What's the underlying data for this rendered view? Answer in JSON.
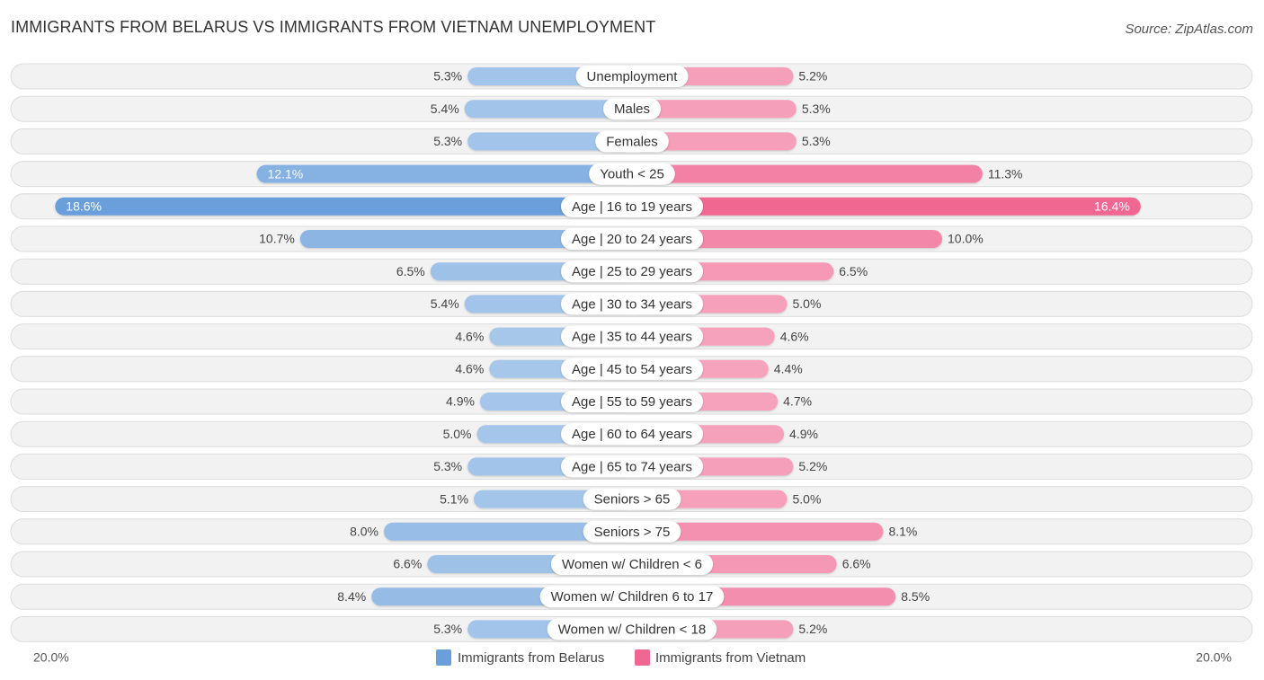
{
  "header": {
    "title": "IMMIGRANTS FROM BELARUS VS IMMIGRANTS FROM VIETNAM UNEMPLOYMENT",
    "source": "Source: ZipAtlas.com"
  },
  "colors": {
    "belarus": "#6a9fdc",
    "belarus_light": "#a9c8eb",
    "vietnam": "#f06792",
    "vietnam_light": "#f6a5bf"
  },
  "chart_data": {
    "type": "bar",
    "orientation": "diverging-horizontal",
    "title": "IMMIGRANTS FROM BELARUS VS IMMIGRANTS FROM VIETNAM UNEMPLOYMENT",
    "categories": [
      "Unemployment",
      "Males",
      "Females",
      "Youth < 25",
      "Age | 16 to 19 years",
      "Age | 20 to 24 years",
      "Age | 25 to 29 years",
      "Age | 30 to 34 years",
      "Age | 35 to 44 years",
      "Age | 45 to 54 years",
      "Age | 55 to 59 years",
      "Age | 60 to 64 years",
      "Age | 65 to 74 years",
      "Seniors > 65",
      "Seniors > 75",
      "Women w/ Children < 6",
      "Women w/ Children 6 to 17",
      "Women w/ Children < 18"
    ],
    "series": [
      {
        "name": "Immigrants from Belarus",
        "side": "left",
        "values": [
          5.3,
          5.4,
          5.3,
          12.1,
          18.6,
          10.7,
          6.5,
          5.4,
          4.6,
          4.6,
          4.9,
          5.0,
          5.3,
          5.1,
          8.0,
          6.6,
          8.4,
          5.3
        ],
        "labels": [
          "5.3%",
          "5.4%",
          "5.3%",
          "12.1%",
          "18.6%",
          "10.7%",
          "6.5%",
          "5.4%",
          "4.6%",
          "4.6%",
          "4.9%",
          "5.0%",
          "5.3%",
          "5.1%",
          "8.0%",
          "6.6%",
          "8.4%",
          "5.3%"
        ]
      },
      {
        "name": "Immigrants from Vietnam",
        "side": "right",
        "values": [
          5.2,
          5.3,
          5.3,
          11.3,
          16.4,
          10.0,
          6.5,
          5.0,
          4.6,
          4.4,
          4.7,
          4.9,
          5.2,
          5.0,
          8.1,
          6.6,
          8.5,
          5.2
        ],
        "labels": [
          "5.2%",
          "5.3%",
          "5.3%",
          "11.3%",
          "16.4%",
          "10.0%",
          "6.5%",
          "5.0%",
          "4.6%",
          "4.4%",
          "4.7%",
          "4.9%",
          "5.2%",
          "5.0%",
          "8.1%",
          "6.6%",
          "8.5%",
          "5.2%"
        ]
      }
    ],
    "xlim": [
      0,
      20
    ],
    "axis_labels": {
      "left": "20.0%",
      "right": "20.0%"
    },
    "unit": "%",
    "legend": {
      "position": "bottom-center",
      "entries": [
        "Immigrants from Belarus",
        "Immigrants from Vietnam"
      ]
    }
  }
}
